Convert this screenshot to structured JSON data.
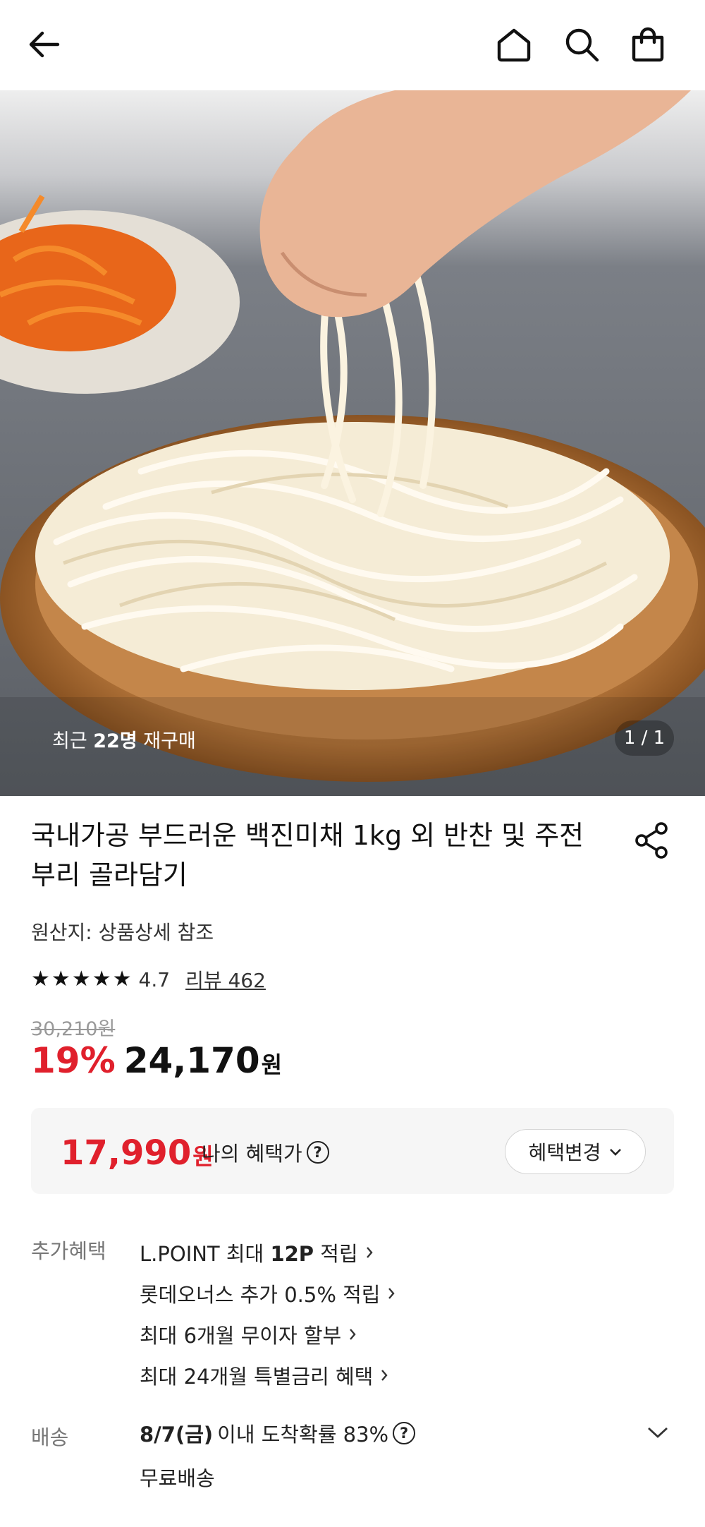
{
  "header": {
    "icons": [
      "back-arrow-icon",
      "home-icon",
      "search-icon",
      "shopping-bag-icon"
    ]
  },
  "hero": {
    "repurchase_prefix": "최근 ",
    "repurchase_count": "22명",
    "repurchase_suffix": " 재구매",
    "counter": "1 / 1"
  },
  "product": {
    "title": "국내가공 부드러운 백진미채 1kg 외 반찬 및 주전부리 골라담기",
    "origin": "원산지: 상품상세 참조",
    "rating": "4.7",
    "stars": 4.7,
    "review_link": "리뷰 462",
    "original_price": "30,210원",
    "discount": "19%",
    "price": "24,170",
    "price_unit": "원"
  },
  "benefit": {
    "price": "17,990",
    "unit": "원",
    "label": "나의 혜택가",
    "change_button": "혜택변경"
  },
  "extra": {
    "label": "추가혜택",
    "items": [
      {
        "pre": "L.POINT 최대 ",
        "bold": "12P",
        "post": " 적립"
      },
      {
        "pre": "롯데오너스 추가 0.5% 적립",
        "bold": "",
        "post": ""
      },
      {
        "pre": "최대 6개월 무이자 할부",
        "bold": "",
        "post": ""
      },
      {
        "pre": "최대 24개월 특별금리 혜택",
        "bold": "",
        "post": ""
      }
    ]
  },
  "shipping": {
    "label": "배송",
    "date": "8/7(금)",
    "info": " 이내 도착확률 83%",
    "fee": "무료배송"
  },
  "colors": {
    "accent": "#e0202c",
    "text": "#111111",
    "muted": "#777777",
    "box_bg": "#f6f6f6"
  }
}
